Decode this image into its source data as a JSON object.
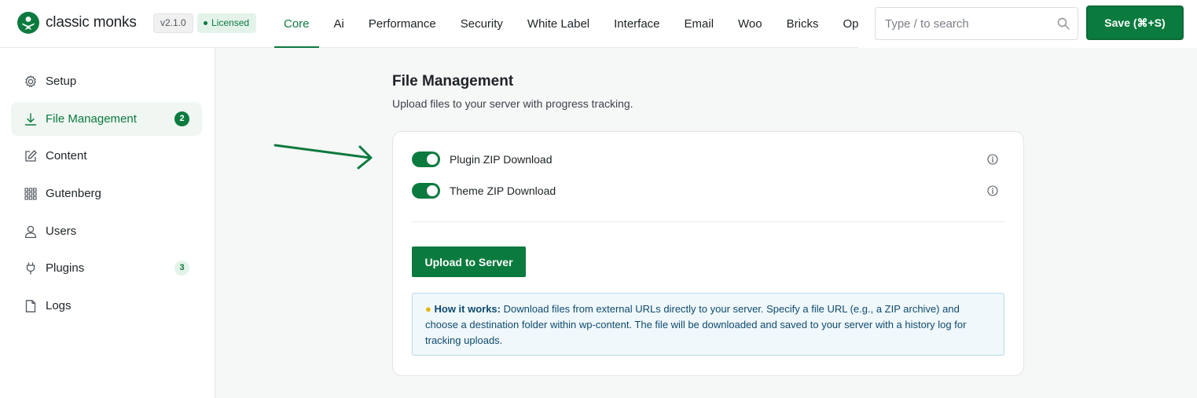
{
  "header": {
    "brand": "classic monks",
    "version": "v2.1.0",
    "license": "Licensed",
    "tabs": [
      {
        "label": "Core"
      },
      {
        "label": "Ai"
      },
      {
        "label": "Performance"
      },
      {
        "label": "Security"
      },
      {
        "label": "White Label"
      },
      {
        "label": "Interface"
      },
      {
        "label": "Email"
      },
      {
        "label": "Woo"
      },
      {
        "label": "Bricks"
      },
      {
        "label": "Opt"
      }
    ],
    "active_tab": "Core",
    "search": {
      "placeholder": "Type / to search",
      "value": ""
    },
    "save_label": "Save (⌘+S)"
  },
  "sidebar": {
    "items": [
      {
        "label": "Setup",
        "icon": "gear-icon"
      },
      {
        "label": "File Management",
        "icon": "download-icon",
        "count": "2",
        "active": true
      },
      {
        "label": "Content",
        "icon": "edit-icon"
      },
      {
        "label": "Gutenberg",
        "icon": "grid-icon"
      },
      {
        "label": "Users",
        "icon": "user-icon"
      },
      {
        "label": "Plugins",
        "icon": "plug-icon",
        "count": "3"
      },
      {
        "label": "Logs",
        "icon": "file-icon"
      }
    ]
  },
  "main": {
    "title": "File Management",
    "subtitle": "Upload files to your server with progress tracking.",
    "toggles": [
      {
        "label": "Plugin ZIP Download",
        "on": true
      },
      {
        "label": "Theme ZIP Download",
        "on": true
      }
    ],
    "upload_label": "Upload to Server",
    "info": {
      "heading": "How it works:",
      "text": "Download files from external URLs directly to your server. Specify a file URL (e.g., a ZIP archive) and choose a destination folder within wp-content. The file will be downloaded and saved to your server with a history log for tracking uploads."
    }
  },
  "colors": {
    "accent": "#0b7a3e",
    "accent_soft": "#e4f3ea",
    "info_bg": "#f0f8fc",
    "info_text": "#0e4a6e"
  }
}
